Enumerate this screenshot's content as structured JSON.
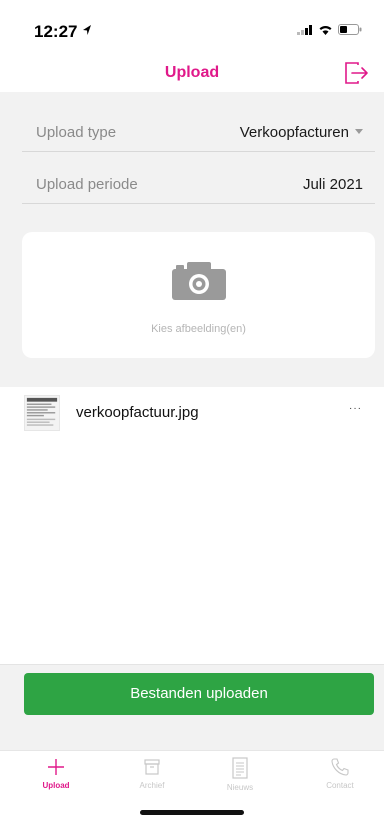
{
  "status": {
    "time": "12:27"
  },
  "nav": {
    "title": "Upload"
  },
  "form": {
    "type_label": "Upload type",
    "type_value": "Verkoopfacturen",
    "period_label": "Upload periode",
    "period_value": "Juli 2021"
  },
  "picker": {
    "hint": "Kies afbeelding(en)"
  },
  "files": [
    {
      "name": "verkoopfactuur.jpg",
      "more": "···"
    }
  ],
  "upload_button": "Bestanden uploaden",
  "tabs": [
    {
      "label": "Upload",
      "icon": "plus-icon"
    },
    {
      "label": "Archief",
      "icon": "archive-icon"
    },
    {
      "label": "Nieuws",
      "icon": "news-icon"
    },
    {
      "label": "Contact",
      "icon": "phone-icon"
    }
  ],
  "colors": {
    "accent": "#e0198a",
    "button": "#2ea444"
  }
}
